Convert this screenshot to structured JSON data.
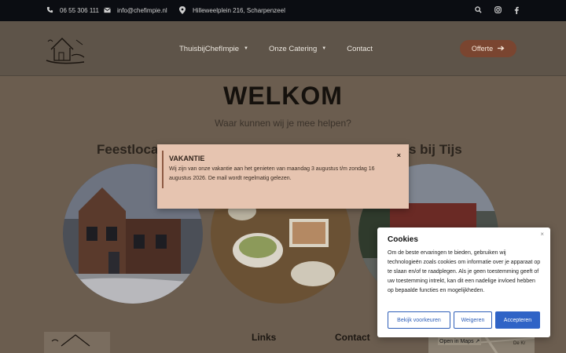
{
  "topbar": {
    "phone": "06 55 306 111",
    "email": "info@chefimpie.nl",
    "address": "Hilleweelplein 216, Scharpenzeel"
  },
  "nav": {
    "items": [
      "ThuisbijChefImpie",
      "Onze Catering",
      "Contact"
    ],
    "cta": "Offerte"
  },
  "main": {
    "title": "WELKOM",
    "subtitle": "Waar kunnen wij je mee helpen?",
    "section_left": "Feestloca",
    "section_right": "s bij Tijs"
  },
  "footer": {
    "links_heading": "Links",
    "contact_heading": "Contact",
    "map_link": "Open in Maps",
    "map_street": "De Kr"
  },
  "modal": {
    "title": "VAKANTIE",
    "text": "Wij zijn van onze vakantie aan het genieten van maandag 3 augustus t/m zondag 16 augustus 2026. De mail wordt regelmatig gelezen.",
    "close": "×"
  },
  "cookies": {
    "title": "Cookies",
    "close": "×",
    "text": "Om de beste ervaringen te bieden, gebruiken wij technologieën zoals cookies om informatie over je apparaat op te slaan en/of te raadplegen. Als je geen toestemming geeft of uw toestemming intrekt, kan dit een nadelige invloed hebben op bepaalde functies en mogelijkheden.",
    "btn_prefs": "Bekijk voorkeuren",
    "btn_deny": "Weigeren",
    "btn_accept": "Accepteren"
  },
  "colors": {
    "topbar": "#0b0d12",
    "accent": "#2f63c6",
    "modal_bg": "#e6c4b0",
    "cta_bg": "#7a4530"
  }
}
